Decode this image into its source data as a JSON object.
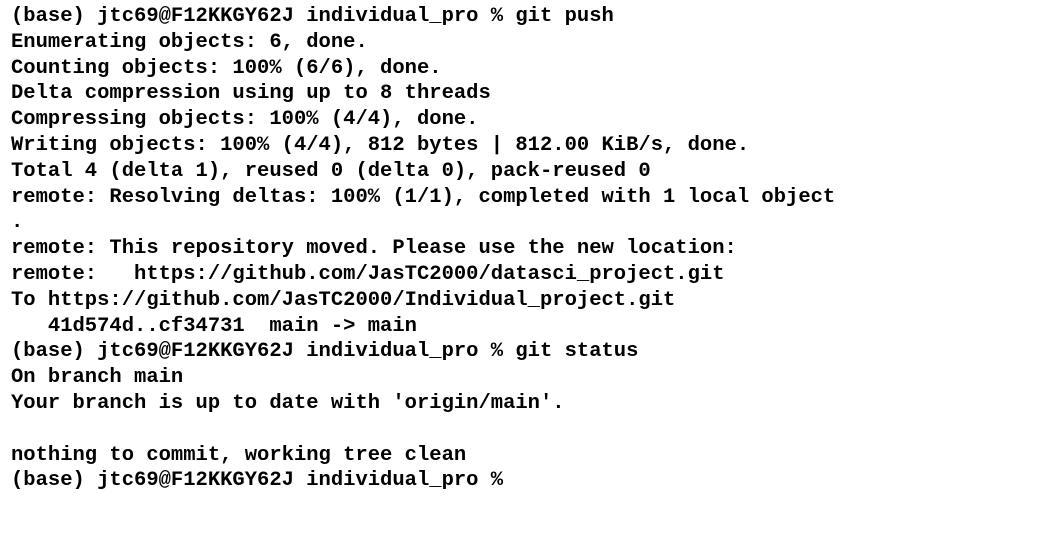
{
  "terminal": {
    "lines": [
      "(base) jtc69@F12KKGY62J individual_pro % git push",
      "Enumerating objects: 6, done.",
      "Counting objects: 100% (6/6), done.",
      "Delta compression using up to 8 threads",
      "Compressing objects: 100% (4/4), done.",
      "Writing objects: 100% (4/4), 812 bytes | 812.00 KiB/s, done.",
      "Total 4 (delta 1), reused 0 (delta 0), pack-reused 0",
      "remote: Resolving deltas: 100% (1/1), completed with 1 local object",
      ".",
      "remote: This repository moved. Please use the new location:",
      "remote:   https://github.com/JasTC2000/datasci_project.git",
      "To https://github.com/JasTC2000/Individual_project.git",
      "   41d574d..cf34731  main -> main",
      "(base) jtc69@F12KKGY62J individual_pro % git status",
      "On branch main",
      "Your branch is up to date with 'origin/main'.",
      "",
      "nothing to commit, working tree clean",
      "(base) jtc69@F12KKGY62J individual_pro % "
    ]
  }
}
